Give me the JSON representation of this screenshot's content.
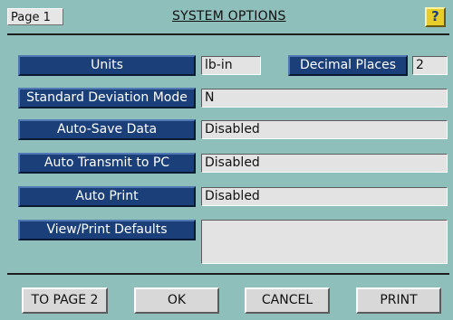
{
  "header": {
    "page_label": "Page 1",
    "title": "SYSTEM OPTIONS",
    "help_label": "?"
  },
  "options": {
    "units_label": "Units",
    "units_value": "lb-in",
    "decimal_places_label": "Decimal Places",
    "decimal_places_value": "2",
    "std_dev_label": "Standard Deviation Mode",
    "std_dev_value": "N",
    "auto_save_label": "Auto-Save Data",
    "auto_save_value": "Disabled",
    "auto_transmit_label": "Auto Transmit to PC",
    "auto_transmit_value": "Disabled",
    "auto_print_label": "Auto Print",
    "auto_print_value": "Disabled",
    "view_print_defaults_label": "View/Print Defaults",
    "view_print_defaults_value": ""
  },
  "footer": {
    "to_page_2": "TO PAGE 2",
    "ok": "OK",
    "cancel": "CANCEL",
    "print": "PRINT"
  },
  "colors": {
    "background": "#8fbfbb",
    "nav_button": "#1b3f78",
    "field": "#e3e3e3",
    "help_button": "#e8cc2a"
  }
}
